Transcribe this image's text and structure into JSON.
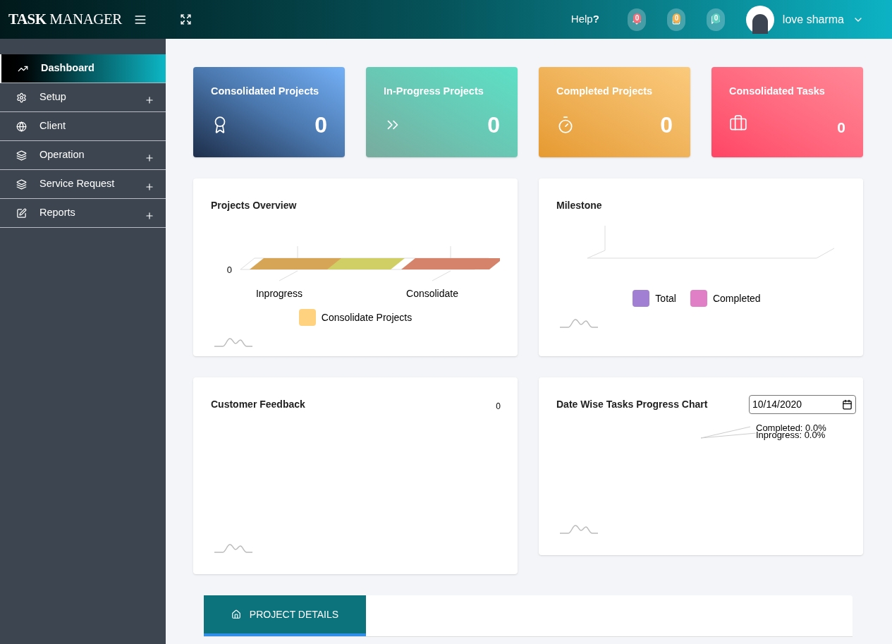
{
  "header": {
    "brand": "**TASK** MANAGER",
    "help": "Help",
    "help_mark": "?",
    "notifications": [
      {
        "kind": "bell",
        "count": "0",
        "color": "#f1707c"
      },
      {
        "kind": "clipboard",
        "count": "0",
        "color": "#f5b04d"
      },
      {
        "kind": "chat",
        "count": "0",
        "color": "#5fcfbf"
      }
    ],
    "user": "love sharma"
  },
  "sidebar": {
    "items": [
      {
        "label": "Dashboard",
        "kind": "chart",
        "selected": true,
        "expandable": false
      },
      {
        "label": "Setup",
        "kind": "gear",
        "selected": false,
        "expandable": true
      },
      {
        "label": "Client",
        "kind": "globe",
        "selected": false,
        "expandable": false
      },
      {
        "label": "Operation",
        "kind": "stack",
        "selected": false,
        "expandable": true
      },
      {
        "label": "Service Request",
        "kind": "stack",
        "selected": false,
        "expandable": true
      },
      {
        "label": "Reports",
        "kind": "edit",
        "selected": false,
        "expandable": true
      }
    ]
  },
  "stat_cards": [
    {
      "title": "Consolidated Projects",
      "value": "0",
      "kind": "award"
    },
    {
      "title": "In-Progress Projects",
      "value": "0",
      "kind": "forward"
    },
    {
      "title": "Completed Projects",
      "value": "0",
      "kind": "timer"
    },
    {
      "title": "Consolidated Tasks",
      "value": "0",
      "kind": "briefcase"
    }
  ],
  "projects_overview": {
    "title": "Projects Overview",
    "axis_label": "0",
    "categories": [
      "Inprogress",
      "Consolidate"
    ],
    "legend": [
      {
        "label": "Consolidate Projects",
        "color": "#ffd280"
      }
    ]
  },
  "milestone": {
    "title": "Milestone",
    "legend": [
      {
        "label": "Total",
        "color": "#a17fd3"
      },
      {
        "label": "Completed",
        "color": "#e07fc5"
      }
    ]
  },
  "customer_feedback": {
    "title": "Customer Feedback",
    "value": "0"
  },
  "date_wise": {
    "title": "Date Wise Tasks Progress Chart",
    "date": "10/14/2020",
    "labels": [
      "Completed: 0.0%",
      "Inprogress: 0.0%"
    ]
  },
  "tabs": [
    {
      "label": "PROJECT DETAILS",
      "selected": true
    }
  ]
}
